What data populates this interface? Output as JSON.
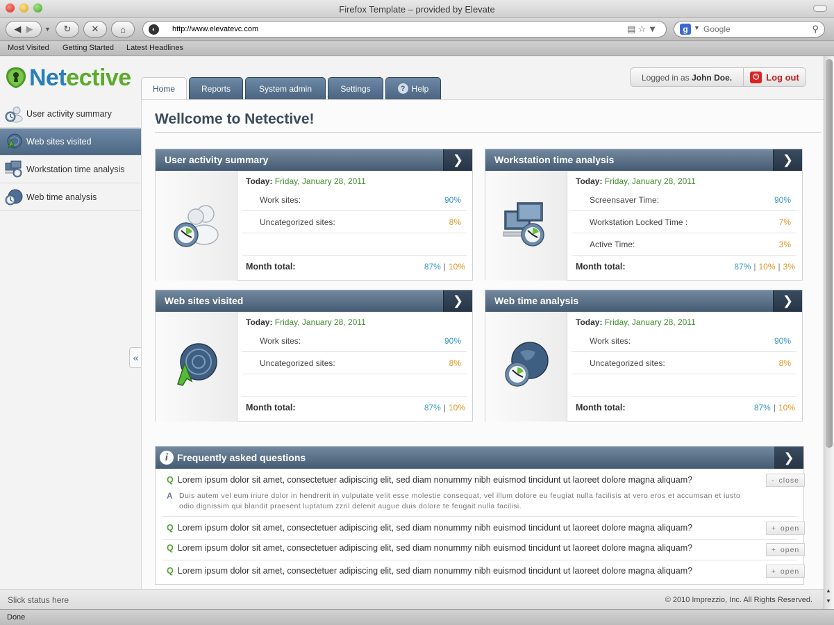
{
  "browser": {
    "window_title": "Firefox Template – provided by Elevate",
    "url": "http://www.elevatevc.com",
    "search_placeholder": "Google",
    "bookmarks": [
      "Most Visited",
      "Getting Started",
      "Latest Headlines"
    ],
    "status": "Done"
  },
  "app": {
    "logo_prefix": "Net",
    "logo_suffix": "ective",
    "tabs": [
      "Home",
      "Reports",
      "System admin",
      "Settings",
      "Help"
    ],
    "active_tab": "Home",
    "user": {
      "prefix": "Logged in as",
      "name": "John Doe.",
      "logout": "Log out"
    },
    "sidebar": [
      {
        "label": "User activity summary",
        "icon": "users-clock-icon"
      },
      {
        "label": "Web sites visited",
        "icon": "globe-cursor-icon",
        "active": true
      },
      {
        "label": "Workstation time analysis",
        "icon": "monitors-icon"
      },
      {
        "label": "Web time analysis",
        "icon": "globe-clock-icon"
      }
    ],
    "collapse": "«",
    "page_title": "Wellcome to Netective!",
    "cards": [
      {
        "title": "User activity summary",
        "today_label": "Today:",
        "date": "Friday, January 28, 2011",
        "rows": [
          {
            "label": "Work sites:",
            "value": "90%",
            "color": "#3a98c5"
          },
          {
            "label": "Uncategorized sites:",
            "value": "8%",
            "color": "#e09520"
          }
        ],
        "total_label": "Month total:",
        "totals": [
          "87%",
          "10%"
        ]
      },
      {
        "title": "Workstation time analysis",
        "today_label": "Today:",
        "date": "Friday, January 28, 2011",
        "rows": [
          {
            "label": "Screensaver Time:",
            "value": "90%",
            "color": "#3a98c5"
          },
          {
            "label": "Workstation Locked Time :",
            "value": "7%",
            "color": "#e09520"
          },
          {
            "label": "Active Time:",
            "value": "3%",
            "color": "#e09520"
          }
        ],
        "total_label": "Month total:",
        "totals": [
          "87%",
          "10%",
          "3%"
        ]
      },
      {
        "title": "Web sites visited",
        "today_label": "Today:",
        "date": "Friday, January 28, 2011",
        "rows": [
          {
            "label": "Work sites:",
            "value": "90%",
            "color": "#3a98c5"
          },
          {
            "label": "Uncategorized sites:",
            "value": "8%",
            "color": "#e09520"
          }
        ],
        "total_label": "Month total:",
        "totals": [
          "87%",
          "10%"
        ]
      },
      {
        "title": "Web time analysis",
        "today_label": "Today:",
        "date": "Friday, January 28, 2011",
        "rows": [
          {
            "label": "Work sites:",
            "value": "90%",
            "color": "#3a98c5"
          },
          {
            "label": "Uncategorized sites:",
            "value": "8%",
            "color": "#e09520"
          }
        ],
        "total_label": "Month total:",
        "totals": [
          "87%",
          "10%"
        ]
      }
    ],
    "faq": {
      "title": "Frequently asked questions",
      "q_marker": "Q",
      "a_marker": "A",
      "items": [
        {
          "question": "Lorem ipsum dolor sit amet, consectetuer adipiscing elit, sed diam nonummy nibh euismod tincidunt ut laoreet dolore magna aliquam?",
          "answer": "Duis autem vel eum iriure dolor in hendrerit in vulputate velit esse molestie consequat, vel illum dolore eu feugiat nulla facilisis at vero eros et accumsan et iusto odio dignissim qui blandit praesent luptatum zzril delenit augue duis dolore te feugait nulla facilisi.",
          "button": "close",
          "button_sign": "-"
        },
        {
          "question": "Lorem ipsum dolor sit amet, consectetuer adipiscing elit, sed diam nonummy nibh euismod tincidunt ut laoreet dolore magna aliquam?",
          "button": "open",
          "button_sign": "+"
        },
        {
          "question": "Lorem ipsum dolor sit amet, consectetuer adipiscing elit, sed diam nonummy nibh euismod tincidunt ut laoreet dolore magna aliquam?",
          "button": "open",
          "button_sign": "+"
        },
        {
          "question": "Lorem ipsum dolor sit amet, consectetuer adipiscing elit, sed diam nonummy nibh euismod tincidunt ut laoreet dolore magna aliquam?",
          "button": "open",
          "button_sign": "+"
        }
      ]
    },
    "footer": {
      "left": "Slick status here",
      "right": "© 2010 Imprezzio, Inc. All Rights Reserved."
    },
    "colors": {
      "accent": "#4a6481",
      "blue_value": "#3a98c5",
      "orange_value": "#e09520",
      "date_green": "#3d8d2a",
      "logout_red": "#c21f1f"
    }
  }
}
